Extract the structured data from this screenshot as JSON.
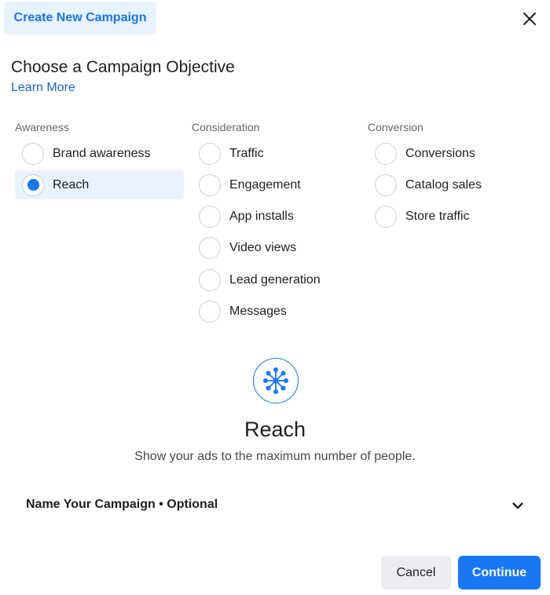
{
  "header": {
    "tab_label": "Create New Campaign",
    "close_icon": "close-icon"
  },
  "objective": {
    "heading": "Choose a Campaign Objective",
    "learn_more": "Learn More"
  },
  "columns": [
    {
      "label": "Awareness",
      "options": [
        "Brand awareness",
        "Reach"
      ]
    },
    {
      "label": "Consideration",
      "options": [
        "Traffic",
        "Engagement",
        "App installs",
        "Video views",
        "Lead generation",
        "Messages"
      ]
    },
    {
      "label": "Conversion",
      "options": [
        "Conversions",
        "Catalog sales",
        "Store traffic"
      ]
    }
  ],
  "selected": "Reach",
  "detail": {
    "icon": "reach-icon",
    "title": "Reach",
    "description": "Show your ads to the maximum number of people."
  },
  "name_section": {
    "label": "Name Your Campaign • Optional",
    "icon": "chevron-down-icon"
  },
  "footer": {
    "cancel_label": "Cancel",
    "continue_label": "Continue"
  },
  "colors": {
    "accent": "#1877f2",
    "accent_light": "#e7f3ff",
    "link": "#1b63c7"
  }
}
